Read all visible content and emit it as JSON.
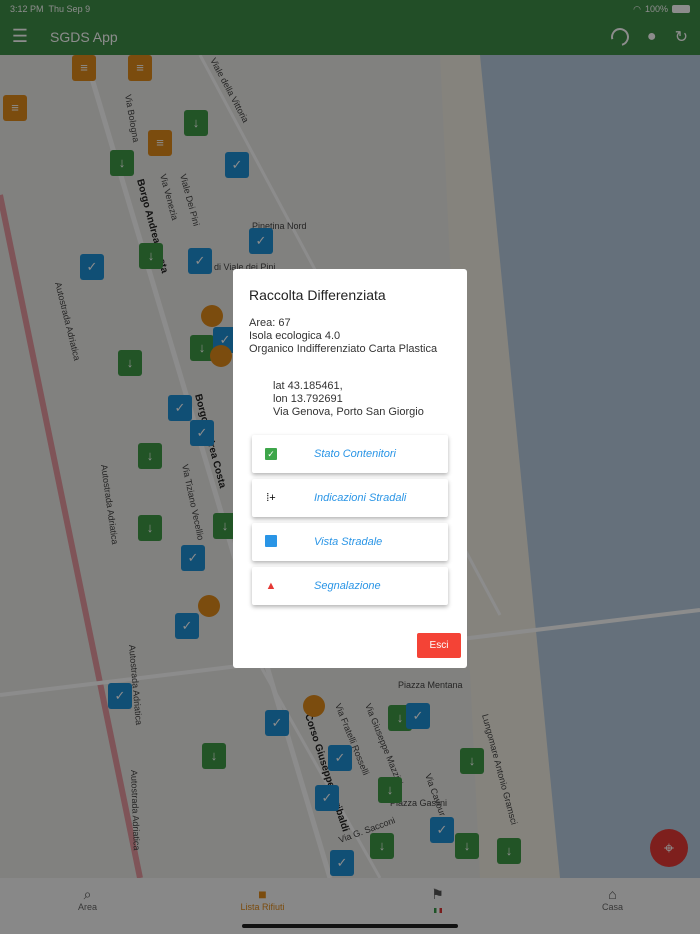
{
  "status_bar": {
    "time": "3:12 PM",
    "date": "Thu Sep 9",
    "battery": "100%"
  },
  "app_bar": {
    "title": "SGDS App",
    "icons": [
      "menu-icon",
      "loading-spinner-icon",
      "location-pin-icon",
      "refresh-icon"
    ]
  },
  "map": {
    "labels": [
      "Borgo Andrea Costa",
      "Borgo Andrea Costa",
      "Autostrada Adriatica",
      "Autostrada Adriatica",
      "Autostrada Adriatica",
      "Autostrada Adriatica",
      "Corso Giuseppe Garibaldi",
      "Pinetina Nord",
      "Via Bologna",
      "Viale della Vittoria",
      "Via Venezia",
      "Viale Dei Pini",
      "Via Tiziano Vecellio",
      "Piazza Mentana",
      "Piazza Gaslini",
      "Via G. Sacconi",
      "Lungomare Antonio Gramsci",
      "Via Giuseppe Mazzini",
      "Via Fratelli Rosselli",
      "Via Cavour",
      "Parco di Viale dei Pini"
    ]
  },
  "dialog": {
    "title": "Raccolta Differenziata",
    "area": "Area: 67",
    "type": "Isola ecologica 4.0",
    "waste": "Organico Indifferenziato Carta Plastica",
    "lat": "lat 43.185461,",
    "lon": "lon 13.792691",
    "address": "Via Genova, Porto San Giorgio",
    "options": [
      {
        "label": "Stato Contenitori",
        "icon": "checkbox-icon"
      },
      {
        "label": "Indicazioni Stradali",
        "icon": "directions-icon"
      },
      {
        "label": "Vista Stradale",
        "icon": "image-icon"
      },
      {
        "label": "Segnalazione",
        "icon": "warning-icon"
      }
    ],
    "exit_label": "Esci"
  },
  "bottom_nav": {
    "tabs": [
      {
        "label": "Area"
      },
      {
        "label": "Lista Rifiuti",
        "active": true
      },
      {
        "label": ""
      },
      {
        "label": "Casa"
      }
    ]
  },
  "colors": {
    "primary": "#3f8f47",
    "accent": "#e08a1a",
    "link": "#2a95e6",
    "danger": "#f44336"
  }
}
